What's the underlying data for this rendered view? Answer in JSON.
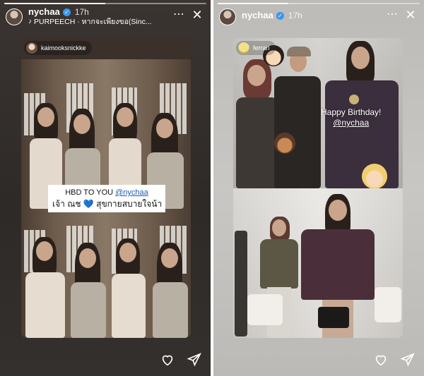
{
  "left_story": {
    "username": "nychaa",
    "time": "17h",
    "music": "PURPEECH · หากจะเพียงขอ(Sinc...",
    "mention_username": "kaimooksnickke",
    "progress": 0.5,
    "caption": {
      "line1_prefix": "HBD TO YOU",
      "line1_handle": "@nychaa",
      "line2_prefix": "เจ้า ณช",
      "line2_heart": "💙",
      "line2_suffix": "สุขกายสบายใจน้า"
    }
  },
  "right_story": {
    "username": "nychaa",
    "time": "17h",
    "mention_username": "ferrari",
    "progress": 0.35,
    "birthday_text": "Happy Birthday!",
    "birthday_handle": "@nychaa"
  },
  "icons": {
    "more": "⋯",
    "close": "✕",
    "verified": "✓",
    "music": "♪"
  },
  "colors": {
    "verified_blue": "#3897f0",
    "link_blue": "#1a5fb4"
  }
}
